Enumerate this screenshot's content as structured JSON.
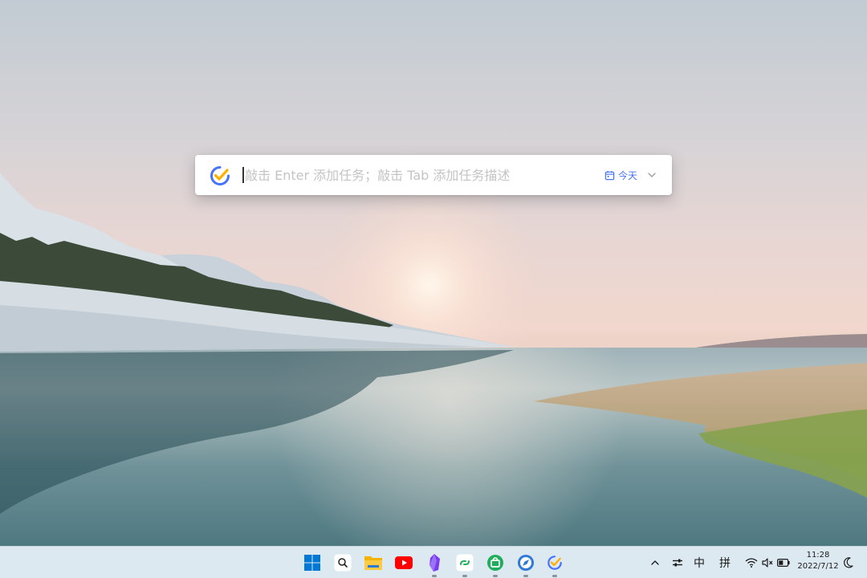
{
  "quick_add": {
    "placeholder": "敲击 Enter 添加任务；敲击 Tab 添加任务描述",
    "date_label": "今天"
  },
  "tray": {
    "ime_mode": "中",
    "ime_method": "拼"
  },
  "clock": {
    "time": "11:28",
    "date": "2022/7/12"
  },
  "colors": {
    "accent": "#4772fa",
    "logo_yellow": "#ffb000",
    "taskbar_bg": "#dde9f1"
  },
  "icons": {
    "app_logo": "ticktick-check-icon",
    "date": "calendar-icon",
    "date_dropdown": "chevron-down-icon"
  }
}
